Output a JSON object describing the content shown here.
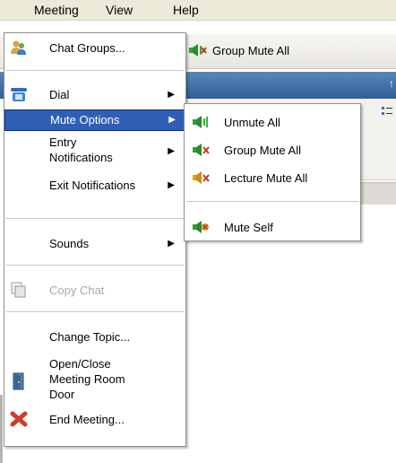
{
  "menubar": {
    "items": [
      "Meeting",
      "View",
      "Help"
    ]
  },
  "toolbar": {
    "group_mute_all_label": "Group Mute All"
  },
  "meeting_menu": {
    "chat_groups": "Chat Groups...",
    "dial": "Dial",
    "mute_options": "Mute Options",
    "entry_notifications_1": "Entry",
    "entry_notifications_2": "Notifications",
    "exit_notifications": "Exit Notifications",
    "sounds": "Sounds",
    "copy_chat": "Copy Chat",
    "change_topic": "Change Topic...",
    "open_close_1": "Open/Close",
    "open_close_2": "Meeting Room",
    "open_close_3": "Door",
    "end_meeting": "End Meeting..."
  },
  "mute_submenu": {
    "unmute_all": "Unmute All",
    "group_mute_all": "Group Mute All",
    "lecture_mute_all": "Lecture Mute All",
    "mute_self": "Mute Self"
  },
  "colors": {
    "selection": "#2f5fb5",
    "titlebar": "#2f5f96",
    "menubar": "#ece9d8"
  },
  "icons": [
    "group-icon",
    "phone-icon",
    "speaker-icon",
    "copy-icon",
    "door-icon",
    "close-icon"
  ]
}
